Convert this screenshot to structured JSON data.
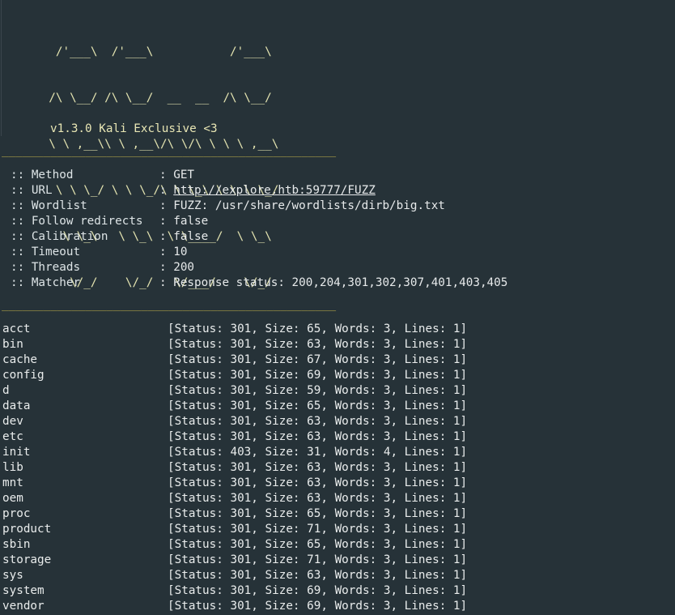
{
  "banner": {
    "logo_lines": [
      [
        "        /'___\\  /'___\\           /'___\\",
        ""
      ],
      [
        "       /\\ \\__/ /\\ \\__/  __  __  /\\ \\__/",
        ""
      ],
      [
        "       \\ \\ ,__\\\\ \\ ,__\\/\\ \\/\\ \\ \\ \\ ,__\\",
        ""
      ],
      [
        "        \\ \\ \\_/ \\ \\ \\_/\\ \\ \\_\\ \\ \\ \\ \\_/",
        ""
      ],
      [
        "         \\ \\_\\   \\ \\_\\  \\ \\____/  \\ \\_\\",
        ""
      ],
      [
        "          \\/_/    \\/_/   \\/___/    \\/_/",
        ""
      ]
    ],
    "version": "v1.3.0 Kali Exclusive <3"
  },
  "separator": "________________________________________________",
  "config": [
    {
      "key": ":: Method",
      "value": "GET",
      "link": false
    },
    {
      "key": ":: URL",
      "value": "http://explore.htb:59777/FUZZ",
      "link": true
    },
    {
      "key": ":: Wordlist",
      "value": "FUZZ: /usr/share/wordlists/dirb/big.txt",
      "link": false
    },
    {
      "key": ":: Follow redirects",
      "value": "false",
      "link": false
    },
    {
      "key": ":: Calibration",
      "value": "false",
      "link": false
    },
    {
      "key": ":: Timeout",
      "value": "10",
      "link": false
    },
    {
      "key": ":: Threads",
      "value": "200",
      "link": false
    },
    {
      "key": ":: Matcher",
      "value": "Response status: 200,204,301,302,307,401,403,405",
      "link": false
    }
  ],
  "results": [
    {
      "path": "acct",
      "meta": "[Status: 301, Size: 65, Words: 3, Lines: 1]"
    },
    {
      "path": "bin",
      "meta": "[Status: 301, Size: 63, Words: 3, Lines: 1]"
    },
    {
      "path": "cache",
      "meta": "[Status: 301, Size: 67, Words: 3, Lines: 1]"
    },
    {
      "path": "config",
      "meta": "[Status: 301, Size: 69, Words: 3, Lines: 1]"
    },
    {
      "path": "d",
      "meta": "[Status: 301, Size: 59, Words: 3, Lines: 1]"
    },
    {
      "path": "data",
      "meta": "[Status: 301, Size: 65, Words: 3, Lines: 1]"
    },
    {
      "path": "dev",
      "meta": "[Status: 301, Size: 63, Words: 3, Lines: 1]"
    },
    {
      "path": "etc",
      "meta": "[Status: 301, Size: 63, Words: 3, Lines: 1]"
    },
    {
      "path": "init",
      "meta": "[Status: 403, Size: 31, Words: 4, Lines: 1]"
    },
    {
      "path": "lib",
      "meta": "[Status: 301, Size: 63, Words: 3, Lines: 1]"
    },
    {
      "path": "mnt",
      "meta": "[Status: 301, Size: 63, Words: 3, Lines: 1]"
    },
    {
      "path": "oem",
      "meta": "[Status: 301, Size: 63, Words: 3, Lines: 1]"
    },
    {
      "path": "proc",
      "meta": "[Status: 301, Size: 65, Words: 3, Lines: 1]"
    },
    {
      "path": "product",
      "meta": "[Status: 301, Size: 71, Words: 3, Lines: 1]"
    },
    {
      "path": "sbin",
      "meta": "[Status: 301, Size: 65, Words: 3, Lines: 1]"
    },
    {
      "path": "storage",
      "meta": "[Status: 301, Size: 71, Words: 3, Lines: 1]"
    },
    {
      "path": "sys",
      "meta": "[Status: 301, Size: 63, Words: 3, Lines: 1]"
    },
    {
      "path": "system",
      "meta": "[Status: 301, Size: 69, Words: 3, Lines: 1]"
    },
    {
      "path": "vendor",
      "meta": "[Status: 301, Size: 69, Words: 3, Lines: 1]"
    }
  ],
  "colors": {
    "background": "#263238",
    "text": "#dde4e6",
    "separator": "#b9aa4a",
    "banner": "#e3e3b0"
  }
}
